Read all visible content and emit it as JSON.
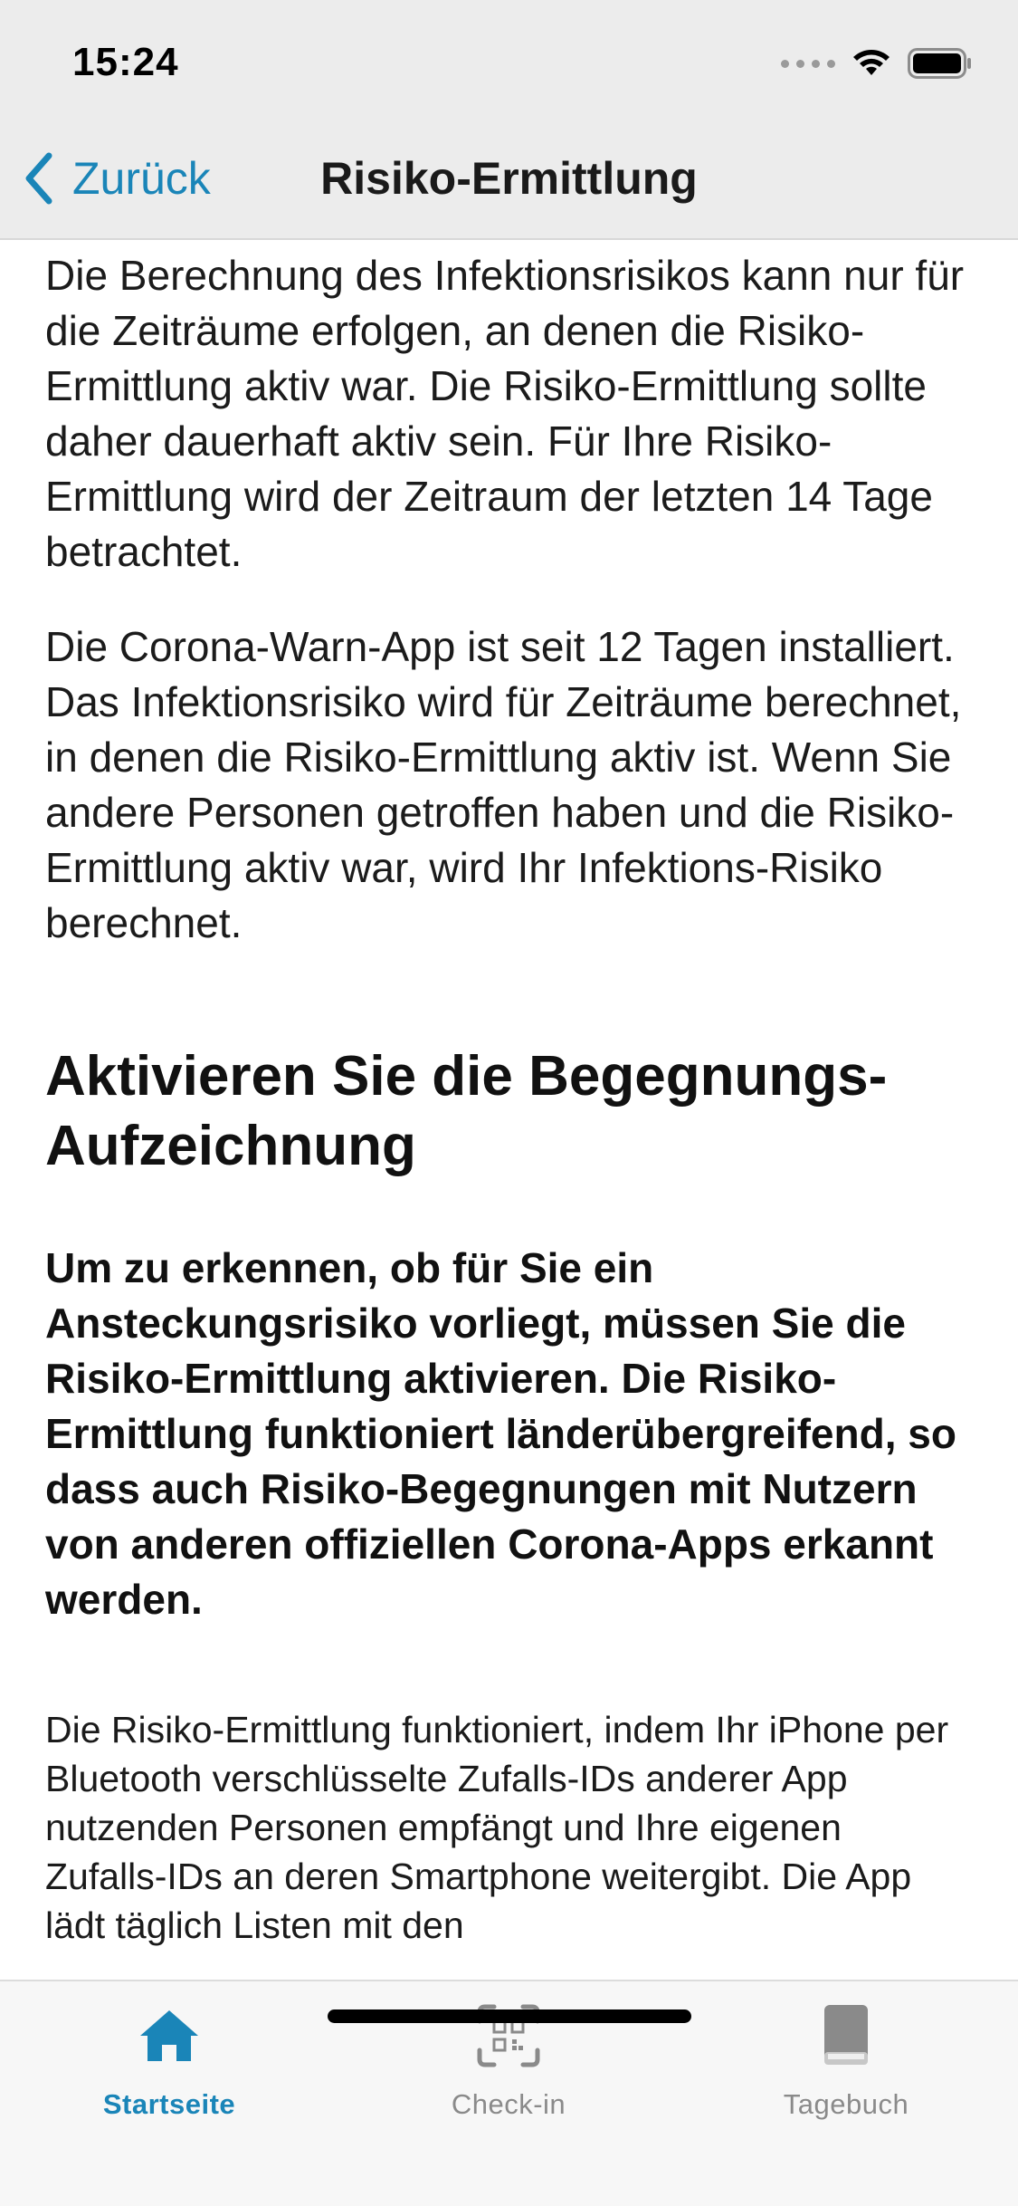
{
  "status_bar": {
    "time": "15:24"
  },
  "nav": {
    "back_label": "Zurück",
    "title": "Risiko-Ermittlung"
  },
  "content": {
    "intro_paragraph": "Die Berechnung des Infektionsrisikos kann nur für die Zeiträume erfolgen, an denen die Risiko-Ermittlung aktiv war. Die Risiko-Ermittlung sollte daher dauerhaft aktiv sein. Für Ihre Risiko-Ermittlung wird der Zeitraum der letzten 14 Tage betrachtet.",
    "install_paragraph": "Die Corona-Warn-App ist seit 12 Tagen installiert. Das Infektionsrisiko wird für Zeiträume berechnet, in denen die Risiko-Ermittlung aktiv ist. Wenn Sie andere Personen getroffen haben und die Risiko-Ermittlung aktiv war, wird Ihr Infektions-Risiko berechnet.",
    "section_heading": "Aktivieren Sie die Begegnungs-Aufzeichnung",
    "bold_paragraph": "Um zu erkennen, ob für Sie ein Ansteckungsrisiko vorliegt, müssen Sie die Risiko-Ermittlung aktivieren. Die Risiko-Ermittlung funktioniert länderübergreifend, so dass auch Risiko-Begegnungen mit Nutzern von anderen offiziellen Corona-Apps erkannt werden.",
    "detail_paragraph": "Die Risiko-Ermittlung funktioniert, indem Ihr iPhone per Bluetooth verschlüsselte Zufalls-IDs anderer App nutzenden Personen empfängt und Ihre eigenen Zufalls-IDs an deren Smartphone weitergibt. Die App lädt täglich Listen mit den"
  },
  "tab_bar": {
    "home_label": "Startseite",
    "checkin_label": "Check-in",
    "diary_label": "Tagebuch"
  },
  "colors": {
    "accent": "#1a85b8",
    "inactive": "#8a8a8a",
    "bar_background": "#ececec"
  },
  "icons": {
    "back": "chevron-left-icon",
    "home": "house-icon",
    "checkin": "qr-scan-icon",
    "diary": "book-icon",
    "wifi": "wifi-icon",
    "battery": "battery-icon",
    "signal": "signal-dots-icon"
  }
}
